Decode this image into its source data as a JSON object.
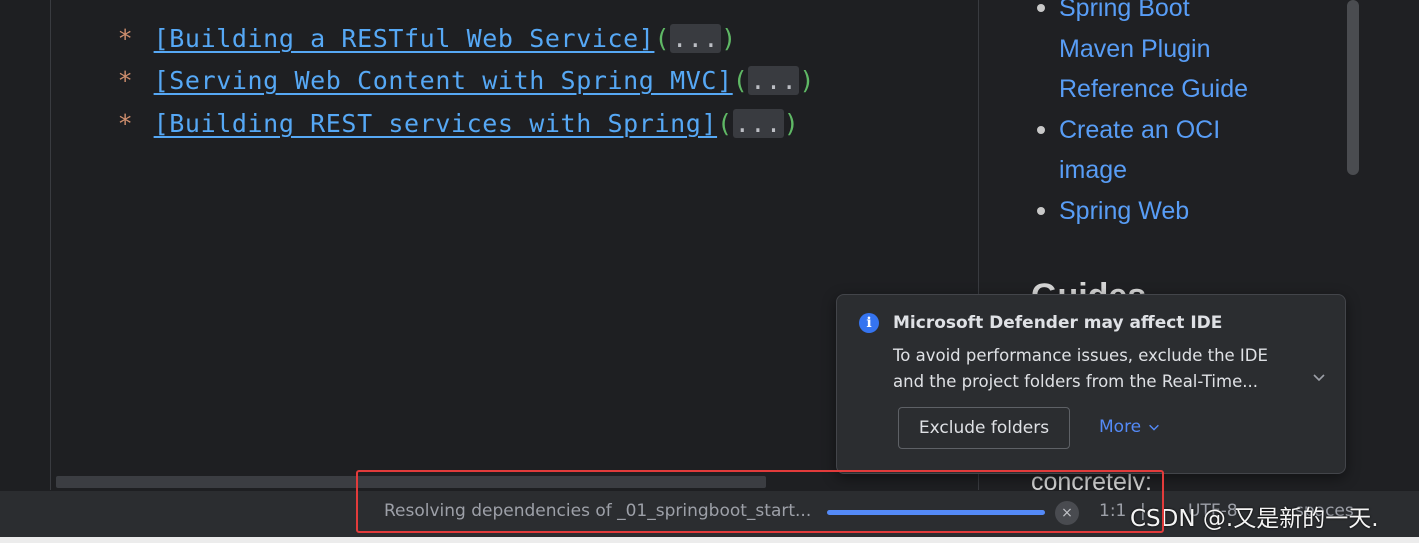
{
  "editor": {
    "lines": [
      {
        "star": "*",
        "link": "[Building a RESTful Web Service]",
        "open": "(",
        "fold": "...",
        "close": ")"
      },
      {
        "star": "*",
        "link": "[Serving Web Content with Spring MVC]",
        "open": "(",
        "fold": "...",
        "close": ")"
      },
      {
        "star": "*",
        "link": "[Building REST services with Spring]",
        "open": "(",
        "fold": "...",
        "close": ")"
      }
    ]
  },
  "preview": {
    "items": [
      "Spring Boot",
      "Maven Plugin",
      "Reference Guide",
      "Create an OCI",
      "image",
      "Spring Web"
    ],
    "heading": "Guides",
    "text": "concretely:"
  },
  "notification": {
    "title": "Microsoft Defender may affect IDE",
    "body_line1": "To avoid performance issues, exclude the IDE",
    "body_line2": "and the project folders from the Real-Time...",
    "exclude_button": "Exclude folders",
    "more_link": "More",
    "info_icon": "i"
  },
  "statusbar": {
    "task_text": "Resolving dependencies of _01_springboot_start...",
    "progress": 1.0,
    "caret_position": "1:1",
    "separator": "|",
    "encoding": "UTF-8",
    "indent": "spaces",
    "cancel_icon": "×"
  },
  "watermark": "CSDN @.又是新的一天.",
  "colors": {
    "accent": "#548af7",
    "link": "#56a8f5",
    "highlight": "#e23b3b"
  }
}
